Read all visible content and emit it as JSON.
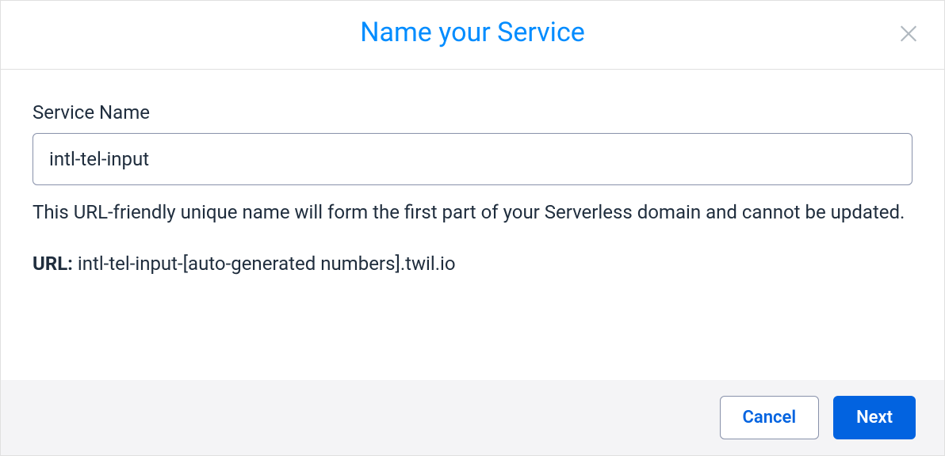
{
  "modal": {
    "title": "Name your Service",
    "field_label": "Service Name",
    "input_value": "intl-tel-input",
    "help_text": "This URL-friendly unique name will form the first part of your Serverless domain and cannot be updated.",
    "url_label": "URL:",
    "url_value": "intl-tel-input-[auto-generated numbers].twil.io",
    "cancel_label": "Cancel",
    "next_label": "Next"
  }
}
